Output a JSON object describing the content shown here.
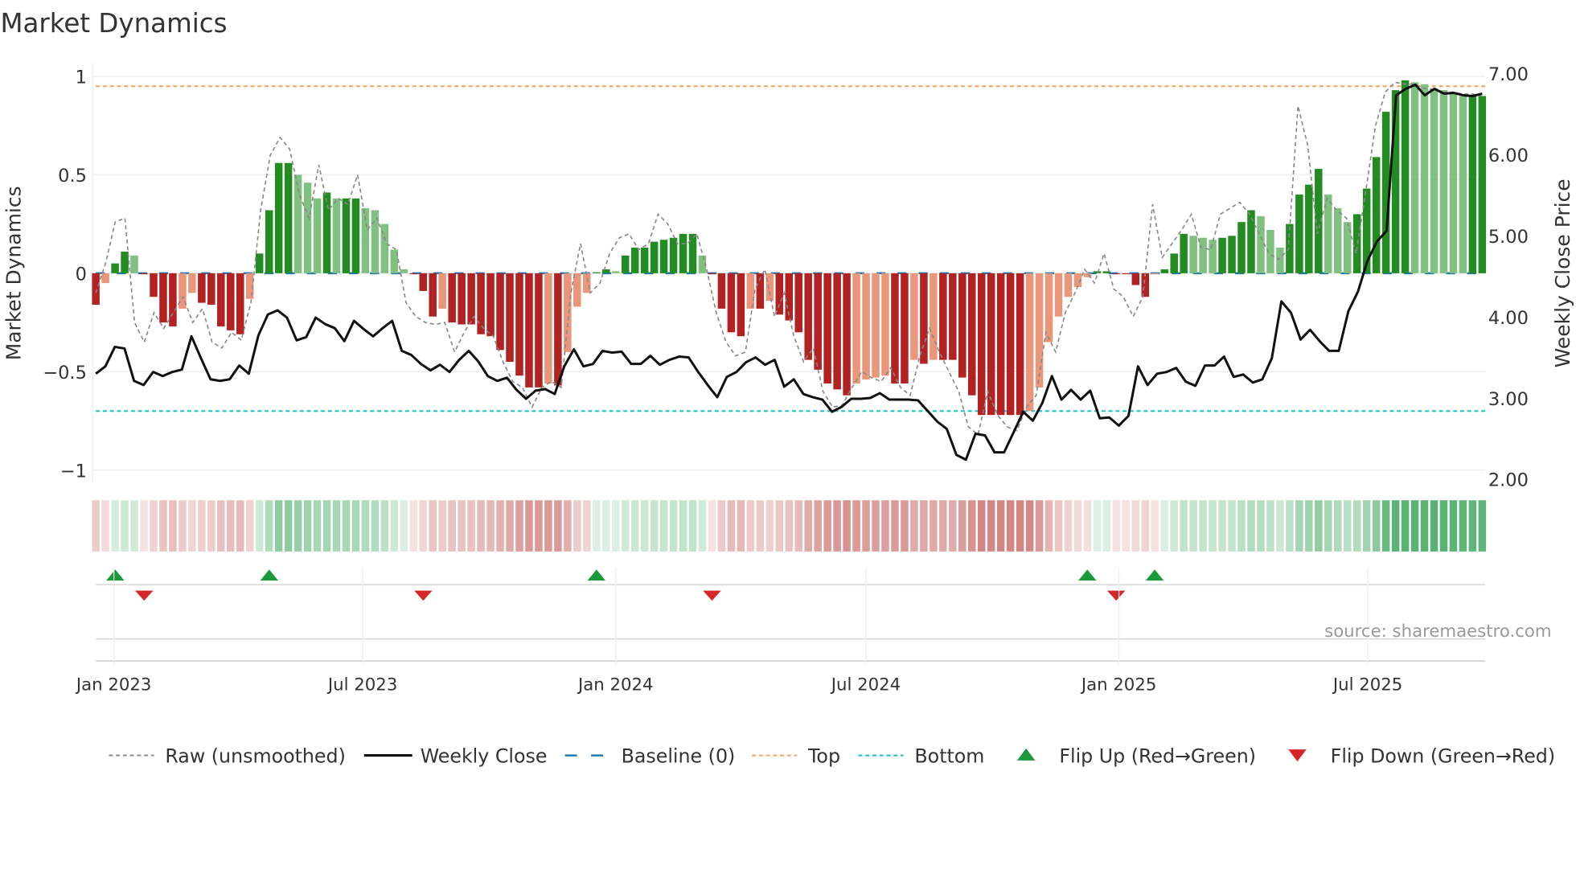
{
  "chart_data": {
    "type": "bar",
    "title": "Market Dynamics",
    "ylabel": "Market Dynamics",
    "y2label": "Weekly Close Price",
    "ylim": [
      -1.05,
      1.05
    ],
    "y2lim": [
      2.0,
      7.0
    ],
    "yticks": [
      {
        "v": 1,
        "label": "1"
      },
      {
        "v": 0.5,
        "label": "0.5"
      },
      {
        "v": 0,
        "label": "0"
      },
      {
        "v": -0.5,
        "label": "−0.5"
      },
      {
        "v": -1,
        "label": "−1"
      }
    ],
    "y2ticks": [
      {
        "v": 7,
        "label": "7.00"
      },
      {
        "v": 6,
        "label": "6.00"
      },
      {
        "v": 5,
        "label": "5.00"
      },
      {
        "v": 4,
        "label": "4.00"
      },
      {
        "v": 3,
        "label": "3.00"
      },
      {
        "v": 2,
        "label": "2.00"
      }
    ],
    "xticks": [
      {
        "date": "2023-01-01",
        "label": "Jan 2023"
      },
      {
        "date": "2023-07-01",
        "label": "Jul 2023"
      },
      {
        "date": "2024-01-01",
        "label": "Jan 2024"
      },
      {
        "date": "2024-07-01",
        "label": "Jul 2024"
      },
      {
        "date": "2025-01-01",
        "label": "Jan 2025"
      },
      {
        "date": "2025-07-01",
        "label": "Jul 2025"
      }
    ],
    "start_week": "2022-12-19",
    "top_level": 0.95,
    "bottom_level": -0.7,
    "baseline": 0,
    "smoothed": [
      -0.16,
      -0.05,
      0.05,
      0.11,
      0.09,
      -0.005,
      -0.12,
      -0.25,
      -0.27,
      -0.18,
      -0.1,
      -0.15,
      -0.16,
      -0.27,
      -0.29,
      -0.31,
      -0.13,
      0.1,
      0.32,
      0.56,
      0.56,
      0.5,
      0.46,
      0.38,
      0.41,
      0.38,
      0.38,
      0.38,
      0.33,
      0.32,
      0.25,
      0.12,
      0.02,
      -0.005,
      -0.09,
      -0.22,
      -0.18,
      -0.25,
      -0.26,
      -0.26,
      -0.31,
      -0.32,
      -0.39,
      -0.45,
      -0.52,
      -0.58,
      -0.58,
      -0.56,
      -0.57,
      -0.4,
      -0.17,
      -0.1,
      0.005,
      0.02,
      0.01,
      0.09,
      0.13,
      0.13,
      0.16,
      0.17,
      0.18,
      0.2,
      0.2,
      0.09,
      -0.005,
      -0.18,
      -0.3,
      -0.32,
      -0.18,
      -0.18,
      -0.14,
      -0.21,
      -0.24,
      -0.3,
      -0.44,
      -0.49,
      -0.56,
      -0.59,
      -0.62,
      -0.56,
      -0.54,
      -0.53,
      -0.52,
      -0.56,
      -0.56,
      -0.44,
      -0.46,
      -0.44,
      -0.44,
      -0.44,
      -0.53,
      -0.62,
      -0.72,
      -0.72,
      -0.72,
      -0.72,
      -0.72,
      -0.7,
      -0.58,
      -0.35,
      -0.22,
      -0.12,
      -0.07,
      -0.02,
      0.01,
      0.01,
      -0.005,
      -0.005,
      -0.06,
      -0.12,
      -0.005,
      0.02,
      0.1,
      0.2,
      0.19,
      0.18,
      0.17,
      0.18,
      0.19,
      0.26,
      0.32,
      0.29,
      0.22,
      0.13,
      0.25,
      0.4,
      0.45,
      0.53,
      0.4,
      0.33,
      0.26,
      0.3,
      0.43,
      0.59,
      0.82,
      0.93,
      0.98,
      0.97,
      0.96,
      0.94,
      0.93,
      0.92,
      0.9,
      0.9,
      0.9
    ],
    "raw": [
      -0.1,
      0.05,
      0.26,
      0.28,
      -0.25,
      -0.35,
      -0.2,
      -0.28,
      -0.2,
      -0.12,
      -0.25,
      -0.18,
      -0.35,
      -0.38,
      -0.3,
      -0.34,
      -0.15,
      0.32,
      0.6,
      0.69,
      0.63,
      0.4,
      0.28,
      0.55,
      0.32,
      0.38,
      0.35,
      0.5,
      0.22,
      0.28,
      0.15,
      0.12,
      -0.15,
      -0.22,
      -0.25,
      -0.26,
      -0.25,
      -0.4,
      -0.3,
      -0.22,
      -0.28,
      -0.32,
      -0.45,
      -0.55,
      -0.58,
      -0.68,
      -0.58,
      -0.55,
      -0.58,
      -0.1,
      0.15,
      -0.1,
      -0.05,
      0.1,
      0.18,
      0.2,
      0.12,
      0.15,
      0.3,
      0.25,
      0.15,
      0.15,
      0.2,
      0.02,
      -0.2,
      -0.35,
      -0.42,
      -0.4,
      -0.08,
      0.02,
      -0.22,
      -0.1,
      -0.32,
      -0.45,
      -0.38,
      -0.6,
      -0.68,
      -0.67,
      -0.58,
      -0.5,
      -0.53,
      -0.55,
      -0.48,
      -0.58,
      -0.62,
      -0.42,
      -0.28,
      -0.4,
      -0.5,
      -0.6,
      -0.78,
      -0.82,
      -0.6,
      -0.72,
      -0.78,
      -0.8,
      -0.68,
      -0.62,
      -0.3,
      -0.4,
      -0.2,
      -0.1,
      0.02,
      -0.05,
      0.1,
      -0.08,
      -0.12,
      -0.22,
      -0.12,
      0.35,
      0.08,
      0.15,
      0.22,
      0.3,
      0.13,
      0.12,
      0.3,
      0.33,
      0.36,
      0.3,
      0.2,
      0.1,
      0.07,
      0.12,
      0.85,
      0.65,
      0.2,
      0.38,
      0.32,
      0.28,
      0.1,
      0.42,
      0.75,
      0.92,
      0.97,
      0.96,
      0.96,
      0.94,
      0.93,
      0.92,
      0.92,
      0.91,
      0.91,
      0.9
    ],
    "close": [
      3.3,
      3.39,
      3.63,
      3.61,
      3.21,
      3.16,
      3.32,
      3.27,
      3.32,
      3.35,
      3.76,
      3.49,
      3.23,
      3.21,
      3.23,
      3.4,
      3.3,
      3.77,
      4.03,
      4.08,
      3.99,
      3.71,
      3.75,
      3.99,
      3.91,
      3.86,
      3.7,
      3.95,
      3.85,
      3.76,
      3.86,
      3.95,
      3.58,
      3.53,
      3.42,
      3.34,
      3.41,
      3.32,
      3.47,
      3.58,
      3.45,
      3.27,
      3.21,
      3.25,
      3.1,
      2.99,
      3.09,
      3.11,
      3.05,
      3.39,
      3.6,
      3.39,
      3.42,
      3.58,
      3.56,
      3.57,
      3.42,
      3.42,
      3.52,
      3.41,
      3.47,
      3.51,
      3.5,
      3.32,
      3.16,
      3.01,
      3.26,
      3.32,
      3.44,
      3.5,
      3.41,
      3.47,
      3.14,
      3.23,
      3.05,
      3.01,
      2.98,
      2.83,
      2.89,
      2.99,
      2.99,
      3.0,
      3.06,
      2.98,
      2.98,
      2.98,
      2.97,
      2.84,
      2.71,
      2.62,
      2.3,
      2.24,
      2.56,
      2.54,
      2.33,
      2.33,
      2.58,
      2.83,
      2.72,
      2.94,
      3.27,
      2.98,
      3.1,
      2.98,
      3.09,
      2.75,
      2.76,
      2.66,
      2.78,
      3.39,
      3.16,
      3.3,
      3.32,
      3.37,
      3.2,
      3.15,
      3.4,
      3.4,
      3.51,
      3.26,
      3.29,
      3.19,
      3.23,
      3.49,
      4.19,
      4.05,
      3.72,
      3.84,
      3.7,
      3.58,
      3.58,
      4.07,
      4.31,
      4.69,
      4.93,
      5.06,
      6.73,
      6.81,
      6.86,
      6.73,
      6.81,
      6.75,
      6.76,
      6.73,
      6.72,
      6.75
    ],
    "flips_up": [
      "2023-01-02",
      "2023-04-24",
      "2023-12-18",
      "2024-12-09",
      "2025-01-27"
    ],
    "flips_down": [
      "2023-01-23",
      "2023-08-14",
      "2024-03-11",
      "2024-12-30"
    ],
    "colors": {
      "up_strong": "#228b22",
      "up_weak": "#80c080",
      "down_strong": "#b22222",
      "down_weak": "#e9967a",
      "close": "#111111",
      "raw": "#888888",
      "baseline": "#1f77b4",
      "top": "#f4a460",
      "bottom": "#17becf",
      "flip_up": "#1a9a3a",
      "flip_down": "#d62728"
    },
    "legend": [
      {
        "key": "raw",
        "label": "Raw (unsmoothed)"
      },
      {
        "key": "close",
        "label": "Weekly Close"
      },
      {
        "key": "baseline",
        "label": "Baseline (0)"
      },
      {
        "key": "top",
        "label": "Top"
      },
      {
        "key": "bottom",
        "label": "Bottom"
      },
      {
        "key": "flip_up",
        "label": "Flip Up (Red→Green)"
      },
      {
        "key": "flip_down",
        "label": "Flip Down (Green→Red)"
      }
    ],
    "legend_position": "bottom",
    "source": "source: sharemaestro.com"
  }
}
